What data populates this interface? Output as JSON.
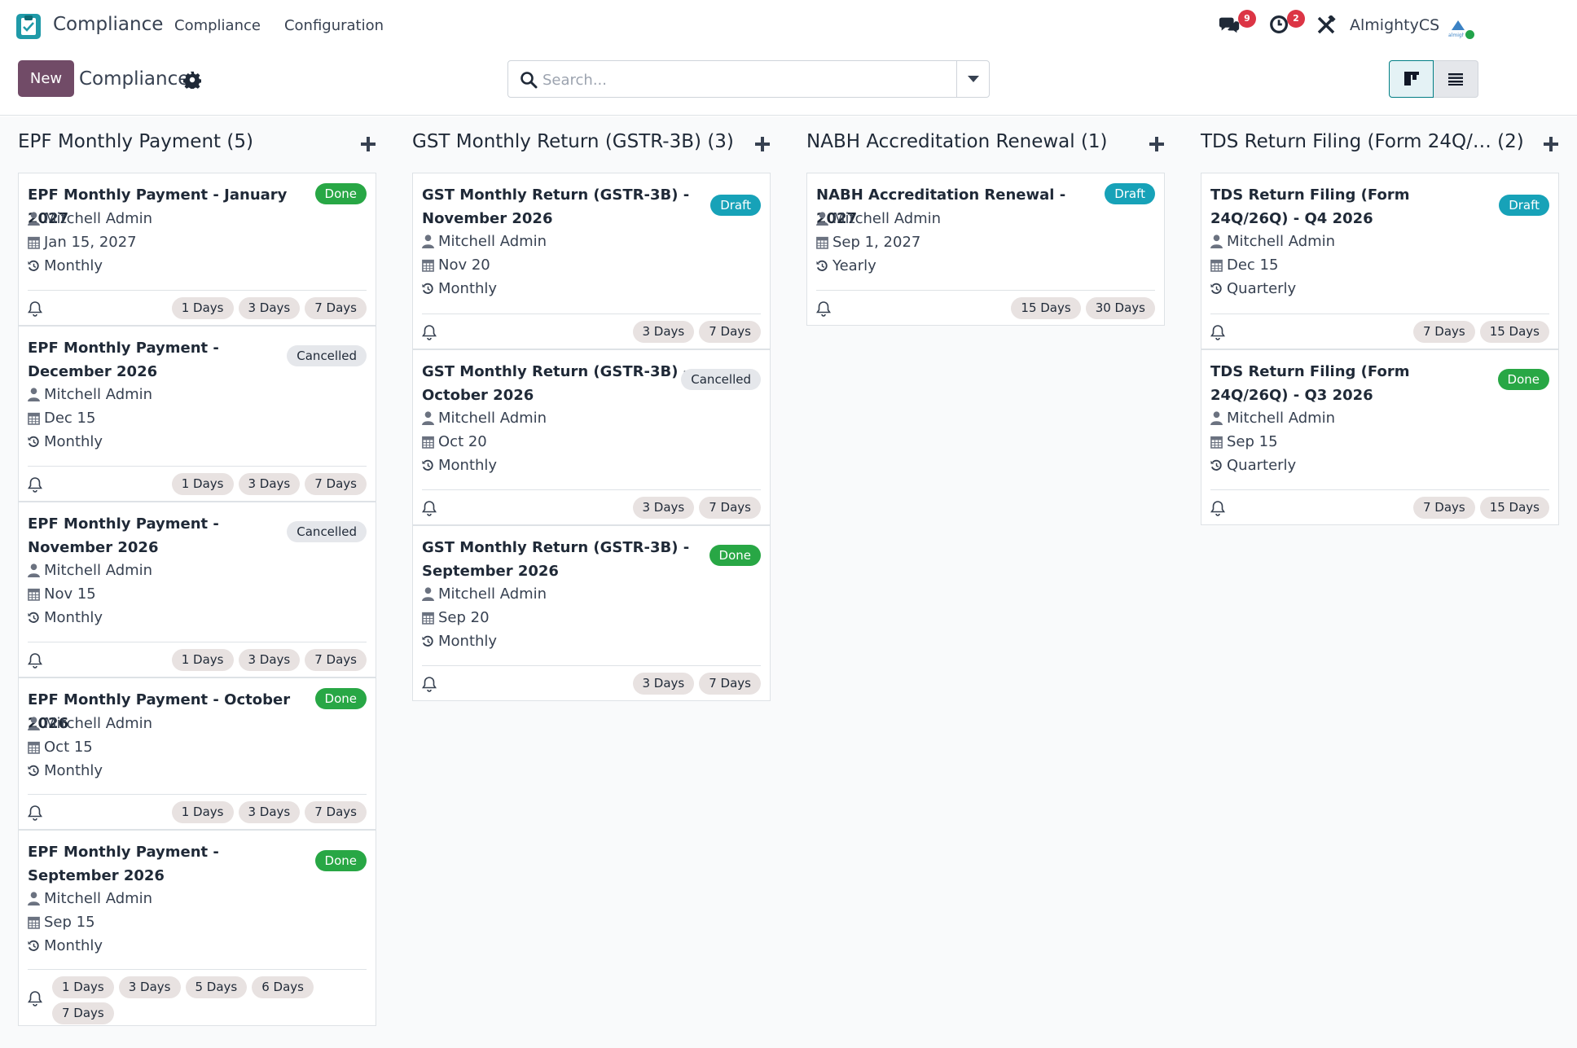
{
  "navbar": {
    "app_name": "Compliance",
    "menu": [
      "Compliance",
      "Configuration"
    ],
    "messages_count": "9",
    "activities_count": "2",
    "company": "AlmightyCS"
  },
  "control": {
    "new_label": "New",
    "title": "Compliance",
    "search_placeholder": "Search..."
  },
  "columns": [
    {
      "name": "EPF Monthly Payment",
      "count": "(5)",
      "cards": [
        {
          "title": "EPF Monthly Payment - January 2027",
          "status": "Done",
          "user": "Mitchell Admin",
          "date": "Jan 15, 2027",
          "recurrence": "Monthly",
          "tags": [
            "1 Days",
            "3 Days",
            "7 Days"
          ]
        },
        {
          "title": "EPF Monthly Payment - December 2026",
          "status": "Cancelled",
          "user": "Mitchell Admin",
          "date": "Dec 15",
          "recurrence": "Monthly",
          "tags": [
            "1 Days",
            "3 Days",
            "7 Days"
          ]
        },
        {
          "title": "EPF Monthly Payment - November 2026",
          "status": "Cancelled",
          "user": "Mitchell Admin",
          "date": "Nov 15",
          "recurrence": "Monthly",
          "tags": [
            "1 Days",
            "3 Days",
            "7 Days"
          ]
        },
        {
          "title": "EPF Monthly Payment - October 2026",
          "status": "Done",
          "user": "Mitchell Admin",
          "date": "Oct 15",
          "recurrence": "Monthly",
          "tags": [
            "1 Days",
            "3 Days",
            "7 Days"
          ]
        },
        {
          "title": "EPF Monthly Payment - September 2026",
          "status": "Done",
          "user": "Mitchell Admin",
          "date": "Sep 15",
          "recurrence": "Monthly",
          "tags": [
            "1 Days",
            "3 Days",
            "5 Days",
            "6 Days",
            "7 Days"
          ]
        }
      ]
    },
    {
      "name": "GST Monthly Return (GSTR-3B)",
      "count": "(3)",
      "cards": [
        {
          "title": "GST Monthly Return (GSTR-3B) - November 2026",
          "status": "Draft",
          "user": "Mitchell Admin",
          "date": "Nov 20",
          "recurrence": "Monthly",
          "tags": [
            "3 Days",
            "7 Days"
          ]
        },
        {
          "title": "GST Monthly Return (GSTR-3B) - October 2026",
          "status": "Cancelled",
          "user": "Mitchell Admin",
          "date": "Oct 20",
          "recurrence": "Monthly",
          "tags": [
            "3 Days",
            "7 Days"
          ]
        },
        {
          "title": "GST Monthly Return (GSTR-3B) - September 2026",
          "status": "Done",
          "user": "Mitchell Admin",
          "date": "Sep 20",
          "recurrence": "Monthly",
          "tags": [
            "3 Days",
            "7 Days"
          ]
        }
      ]
    },
    {
      "name": "NABH Accreditation Renewal",
      "count": "(1)",
      "cards": [
        {
          "title": "NABH Accreditation Renewal - 2027",
          "status": "Draft",
          "user": "Mitchell Admin",
          "date": "Sep 1, 2027",
          "recurrence": "Yearly",
          "tags": [
            "15 Days",
            "30 Days"
          ]
        }
      ]
    },
    {
      "name": "TDS Return Filing (Form 24Q/…",
      "count": "(2)",
      "cards": [
        {
          "title": "TDS Return Filing (Form 24Q/26Q) - Q4 2026",
          "status": "Draft",
          "user": "Mitchell Admin",
          "date": "Dec 15",
          "recurrence": "Quarterly",
          "tags": [
            "7 Days",
            "15 Days"
          ]
        },
        {
          "title": "TDS Return Filing (Form 24Q/26Q) - Q3 2026",
          "status": "Done",
          "user": "Mitchell Admin",
          "date": "Sep 15",
          "recurrence": "Quarterly",
          "tags": [
            "7 Days",
            "15 Days"
          ]
        }
      ]
    }
  ]
}
